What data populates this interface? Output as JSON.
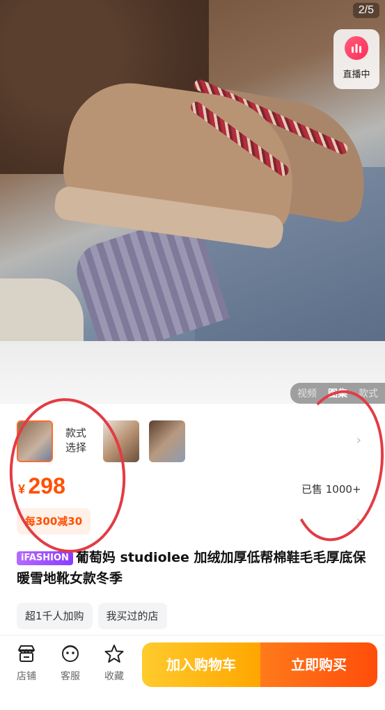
{
  "gallery": {
    "counter": "2/5",
    "live_label": "直播中",
    "media_tabs": [
      "视频",
      "图集",
      "款式"
    ],
    "active_tab": "图集"
  },
  "sku": {
    "label_line1": "款式",
    "label_line2": "选择"
  },
  "price": {
    "currency": "¥",
    "value": "298",
    "sold": "已售 1000+"
  },
  "promo": "每300减30",
  "product": {
    "tag": "iFASHION",
    "title": "葡萄妈 studiolee 加绒加厚低帮棉鞋毛毛厚底保暖雪地靴女款冬季"
  },
  "chips": [
    "超1千人加购",
    "我买过的店"
  ],
  "bottom_nav": [
    {
      "icon": "store-icon",
      "label": "店铺"
    },
    {
      "icon": "customer-service-icon",
      "label": "客服"
    },
    {
      "icon": "star-icon",
      "label": "收藏"
    }
  ],
  "actions": {
    "add_to_cart": "加入购物车",
    "buy_now": "立即购买"
  },
  "colors": {
    "price": "#ff5000",
    "annotation": "#e23b45",
    "cart_button": "#ffa600",
    "buy_button": "#ff4d0a"
  }
}
